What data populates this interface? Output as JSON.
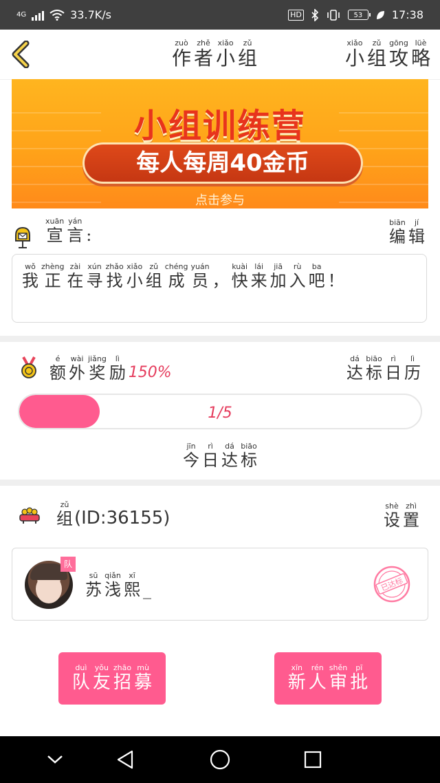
{
  "status_bar": {
    "network": "4G",
    "speed": "33.7K/s",
    "hd": "HD",
    "battery": "53",
    "time": "17:38"
  },
  "header": {
    "title_chars": [
      {
        "py": "zuò",
        "hz": "作"
      },
      {
        "py": "zhě",
        "hz": "者"
      },
      {
        "py": "xiǎo",
        "hz": "小"
      },
      {
        "py": "zǔ",
        "hz": "组"
      }
    ],
    "strategy_chars": [
      {
        "py": "xiǎo",
        "hz": "小"
      },
      {
        "py": "zǔ",
        "hz": "组"
      },
      {
        "py": "gōng",
        "hz": "攻"
      },
      {
        "py": "lüè",
        "hz": "略"
      }
    ]
  },
  "banner": {
    "title": "小组训练营",
    "subtitle": "每人每周40金币",
    "cta": "点击参与"
  },
  "slogan": {
    "label_chars": [
      {
        "py": "xuān",
        "hz": "宣"
      },
      {
        "py": "yán",
        "hz": "言"
      }
    ],
    "colon": ":",
    "edit_chars": [
      {
        "py": "biān",
        "hz": "编"
      },
      {
        "py": "jí",
        "hz": "辑"
      }
    ],
    "text_chars": [
      {
        "py": "wǒ",
        "hz": "我"
      },
      {
        "py": "zhèng",
        "hz": "正"
      },
      {
        "py": "zài",
        "hz": "在"
      },
      {
        "py": "xún",
        "hz": "寻"
      },
      {
        "py": "zhǎo",
        "hz": "找"
      },
      {
        "py": "xiǎo",
        "hz": "小"
      },
      {
        "py": "zǔ",
        "hz": "组"
      },
      {
        "py": "chéng",
        "hz": "成"
      },
      {
        "py": "yuán",
        "hz": "员"
      },
      {
        "py": "",
        "hz": "，"
      },
      {
        "py": "kuài",
        "hz": "快"
      },
      {
        "py": "lái",
        "hz": "来"
      },
      {
        "py": "jiā",
        "hz": "加"
      },
      {
        "py": "rù",
        "hz": "入"
      },
      {
        "py": "ba",
        "hz": "吧"
      },
      {
        "py": "",
        "hz": "！"
      }
    ]
  },
  "reward": {
    "label_chars": [
      {
        "py": "é",
        "hz": "额"
      },
      {
        "py": "wài",
        "hz": "外"
      },
      {
        "py": "jiǎng",
        "hz": "奖"
      },
      {
        "py": "lì",
        "hz": "励"
      }
    ],
    "percent": "150%",
    "calendar_chars": [
      {
        "py": "dá",
        "hz": "达"
      },
      {
        "py": "biāo",
        "hz": "标"
      },
      {
        "py": "rì",
        "hz": "日"
      },
      {
        "py": "lì",
        "hz": "历"
      }
    ],
    "progress_text": "1/5",
    "progress_fraction": 0.2,
    "today_chars": [
      {
        "py": "jīn",
        "hz": "今"
      },
      {
        "py": "rì",
        "hz": "日"
      },
      {
        "py": "dá",
        "hz": "达"
      },
      {
        "py": "biāo",
        "hz": "标"
      }
    ]
  },
  "group": {
    "label_chars": [
      {
        "py": "zǔ",
        "hz": "组"
      }
    ],
    "id_text": "(ID:36155)",
    "settings_chars": [
      {
        "py": "shè",
        "hz": "设"
      },
      {
        "py": "zhì",
        "hz": "置"
      }
    ],
    "member": {
      "badge": "队",
      "name_chars": [
        {
          "py": "sū",
          "hz": "苏"
        },
        {
          "py": "qiǎn",
          "hz": "浅"
        },
        {
          "py": "xī",
          "hz": "熙"
        },
        {
          "py": "",
          "hz": "_"
        }
      ],
      "stamp_text": "已达标"
    }
  },
  "buttons": {
    "recruit_chars": [
      {
        "py": "duì",
        "hz": "队"
      },
      {
        "py": "yǒu",
        "hz": "友"
      },
      {
        "py": "zhāo",
        "hz": "招"
      },
      {
        "py": "mù",
        "hz": "募"
      }
    ],
    "approve_chars": [
      {
        "py": "xīn",
        "hz": "新"
      },
      {
        "py": "rén",
        "hz": "人"
      },
      {
        "py": "shěn",
        "hz": "审"
      },
      {
        "py": "pī",
        "hz": "批"
      }
    ]
  },
  "colors": {
    "accent_pink": "#ff5b8f",
    "text_red": "#e53b5c",
    "banner_orange": "#ffa319"
  }
}
